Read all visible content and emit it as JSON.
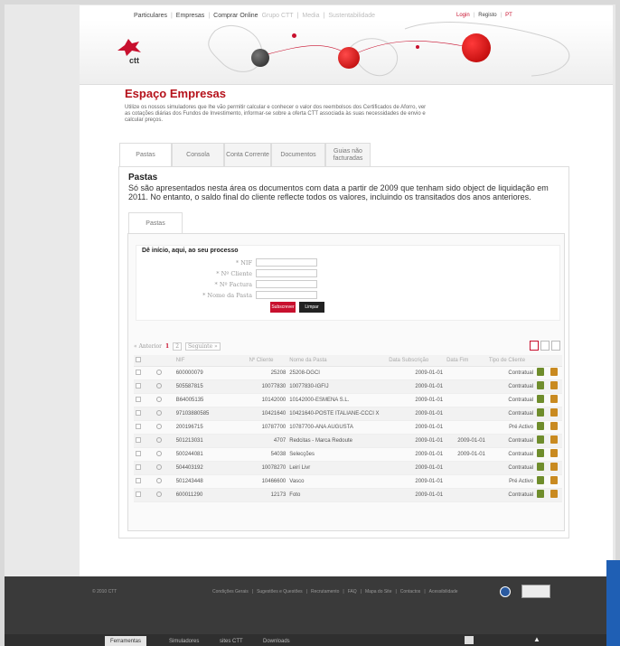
{
  "topnav": {
    "links": [
      "Particulares",
      "Empresas",
      "Comprar Online",
      "Grupo CTT",
      "Media",
      "Sustentabilidade"
    ],
    "right": [
      "Login",
      "Registo",
      "PT"
    ]
  },
  "logo_text": "ctt",
  "page": {
    "title": "Espaço Empresas",
    "intro": "Utilize os nossos simuladores que lhe vão permitir calcular e conhecer o valor dos reembolsos dos Certificados de Aforro, ver as cotações diárias dos Fundos de Investimento, informar-se sobre a oferta CTT associada às suas necessidades de envio e calcular preços."
  },
  "tabs": [
    {
      "label": "Pastas"
    },
    {
      "label": "Consola"
    },
    {
      "label": "Conta Corrente"
    },
    {
      "label": "Documentos"
    },
    {
      "label": "Guias não facturadas"
    }
  ],
  "panel": {
    "title": "Pastas",
    "description": "Só são apresentados nesta área os documentos com data a partir de 2009 que tenham sido object de liquidação em 2011. No entanto, o saldo final do cliente reflecte todos os valores, incluindo os transitados dos anos anteriores.",
    "subtab": "Pastas"
  },
  "form": {
    "title": "Dê início, aqui, ao seu processo",
    "fields": [
      "* NIF",
      "* Nº Cliente",
      "* Nº Factura",
      "* Nome da Pasta"
    ],
    "submit": "Subscrever",
    "clear": "Limpar"
  },
  "pager": {
    "prev": "« Anterior",
    "pages": [
      "1",
      "2"
    ],
    "next": "Seguinte »"
  },
  "table": {
    "headers": [
      "",
      "",
      "NIF",
      "Nº Cliente",
      "Nome da Pasta",
      "Data Subscrição",
      "Data Fim",
      "Tipo de Cliente",
      "",
      ""
    ],
    "rows": [
      {
        "nif": "600000079",
        "cliente": "25208",
        "nome": "25208-DGCI",
        "data": "2009-01-01",
        "fim": "",
        "tipo": "Contratual"
      },
      {
        "nif": "505587815",
        "cliente": "10077830",
        "nome": "10077830-IGFIJ",
        "data": "2009-01-01",
        "fim": "",
        "tipo": "Contratual"
      },
      {
        "nif": "B64005135",
        "cliente": "10142000",
        "nome": "10142000-ESMENA S.L.",
        "data": "2009-01-01",
        "fim": "",
        "tipo": "Contratual"
      },
      {
        "nif": "97103880585",
        "cliente": "10421640",
        "nome": "10421640-POSTE ITALIANE-CCCI X",
        "data": "2009-01-01",
        "fim": "",
        "tipo": "Contratual"
      },
      {
        "nif": "200196715",
        "cliente": "10787700",
        "nome": "10787700-ANA AUGUSTA",
        "data": "2009-01-01",
        "fim": "",
        "tipo": "Pré Activo"
      },
      {
        "nif": "501213031",
        "cliente": "4707",
        "nome": "Redcitas - Marca Redoute",
        "data": "2009-01-01",
        "fim": "2009-01-01",
        "tipo": "Contratual"
      },
      {
        "nif": "500244081",
        "cliente": "54038",
        "nome": "Selecções",
        "data": "2009-01-01",
        "fim": "2009-01-01",
        "tipo": "Contratual"
      },
      {
        "nif": "504403192",
        "cliente": "10078270",
        "nome": "Leirí Livr",
        "data": "2009-01-01",
        "fim": "",
        "tipo": "Contratual"
      },
      {
        "nif": "501243448",
        "cliente": "10466600",
        "nome": "Vasco",
        "data": "2009-01-01",
        "fim": "",
        "tipo": "Pré Activo"
      },
      {
        "nif": "600011290",
        "cliente": "12173",
        "nome": "Foto",
        "data": "2009-01-01",
        "fim": "",
        "tipo": "Contratual"
      }
    ]
  },
  "footer": {
    "copyright": "© 2010 CTT",
    "links": [
      "Condições Gerais",
      "Sugestões e Questões",
      "Recrutamento",
      "FAQ",
      "Mapa do Site",
      "Contactos",
      "Acessibilidade"
    ]
  },
  "bottombar": [
    "Ferramentas",
    "Simuladores",
    "sites CTT",
    "Downloads"
  ],
  "colors": {
    "brand_red": "#c8102e",
    "footer": "#3a3a3a"
  }
}
